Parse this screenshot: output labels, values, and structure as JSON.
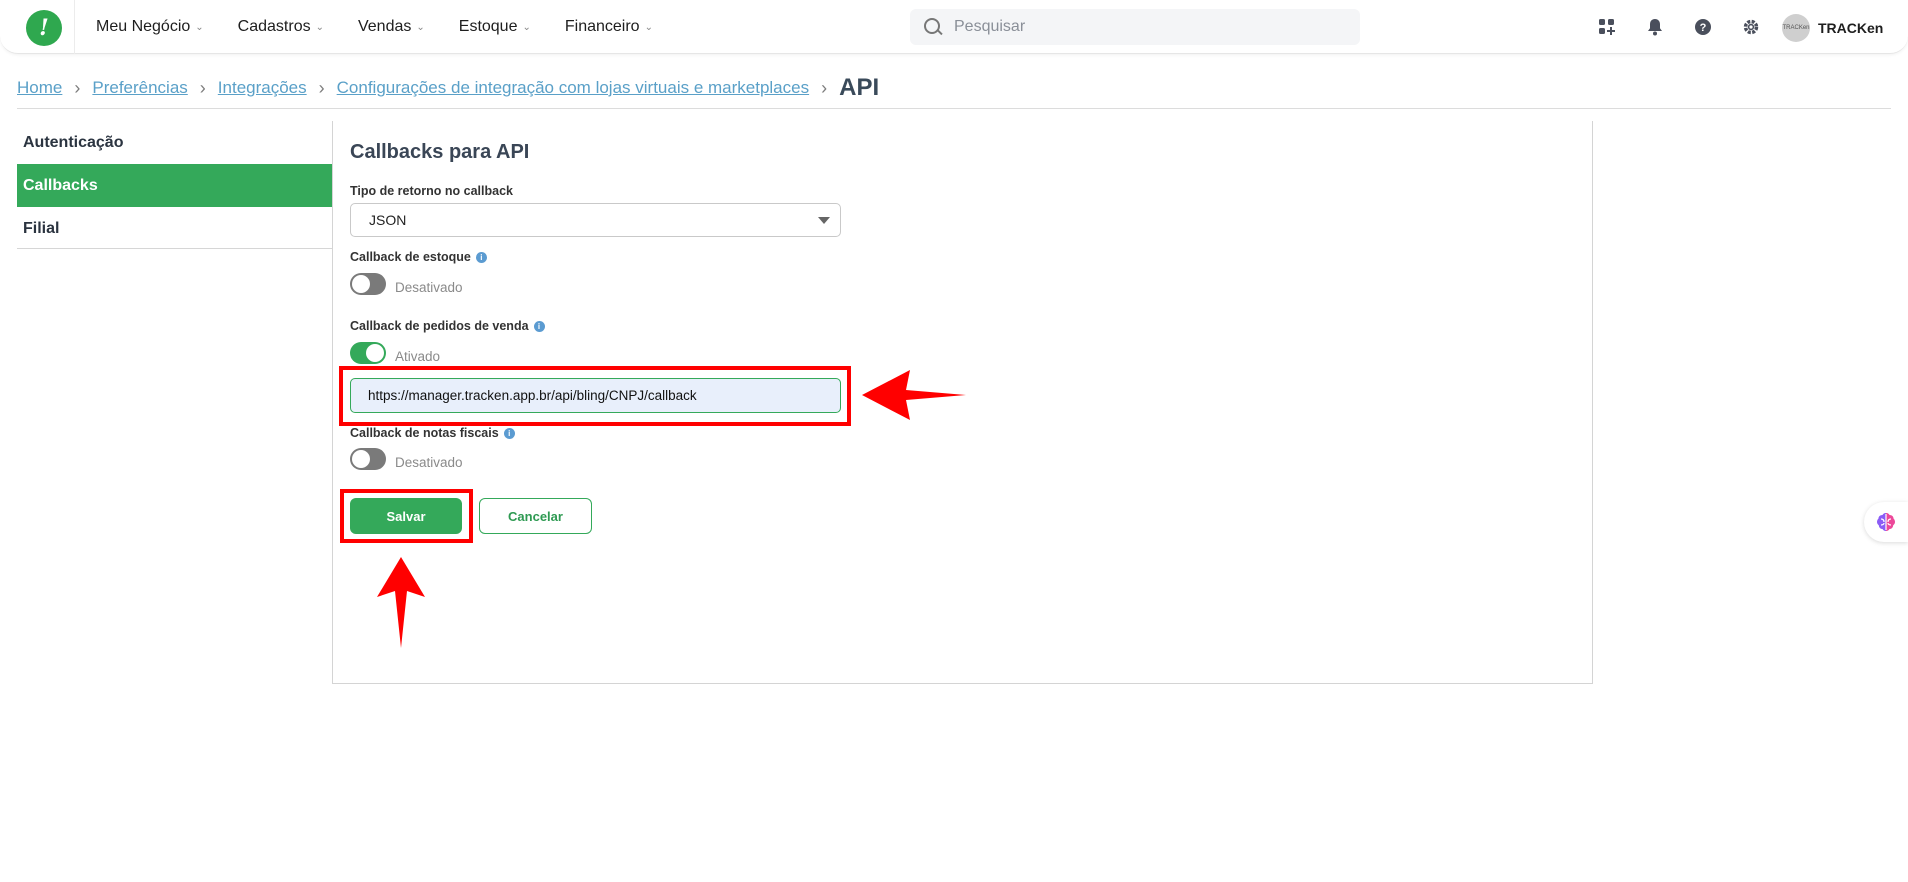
{
  "nav": {
    "menu": [
      {
        "label": "Meu Negócio"
      },
      {
        "label": "Cadastros"
      },
      {
        "label": "Vendas"
      },
      {
        "label": "Estoque"
      },
      {
        "label": "Financeiro"
      }
    ],
    "search_placeholder": "Pesquisar",
    "user": {
      "name": "TRACKen",
      "avatar_text": "TRACKen"
    },
    "icons": [
      "apps-grid-icon",
      "bell-icon",
      "help-icon",
      "gear-icon"
    ]
  },
  "breadcrumb": {
    "links": [
      "Home",
      "Preferências",
      "Integrações",
      "Configurações de integração com lojas virtuais e marketplaces"
    ],
    "current": "API"
  },
  "sidebar": {
    "items": [
      {
        "label": "Autenticação"
      },
      {
        "label": "Callbacks"
      },
      {
        "label": "Filial"
      }
    ],
    "active_index": 1
  },
  "form": {
    "title": "Callbacks para API",
    "return_type_label": "Tipo de retorno no callback",
    "return_type_value": "JSON",
    "stock_label": "Callback de estoque",
    "stock_state": "Desativado",
    "orders_label": "Callback de pedidos de venda",
    "orders_state": "Ativado",
    "orders_url": "https://manager.tracken.app.br/api/bling/CNPJ/callback",
    "invoices_label": "Callback de notas fiscais",
    "invoices_state": "Desativado",
    "save_label": "Salvar",
    "cancel_label": "Cancelar"
  },
  "colors": {
    "brand_green": "#34a95a",
    "link_blue": "#5aa0c8",
    "annotation_red": "#ff0000"
  }
}
